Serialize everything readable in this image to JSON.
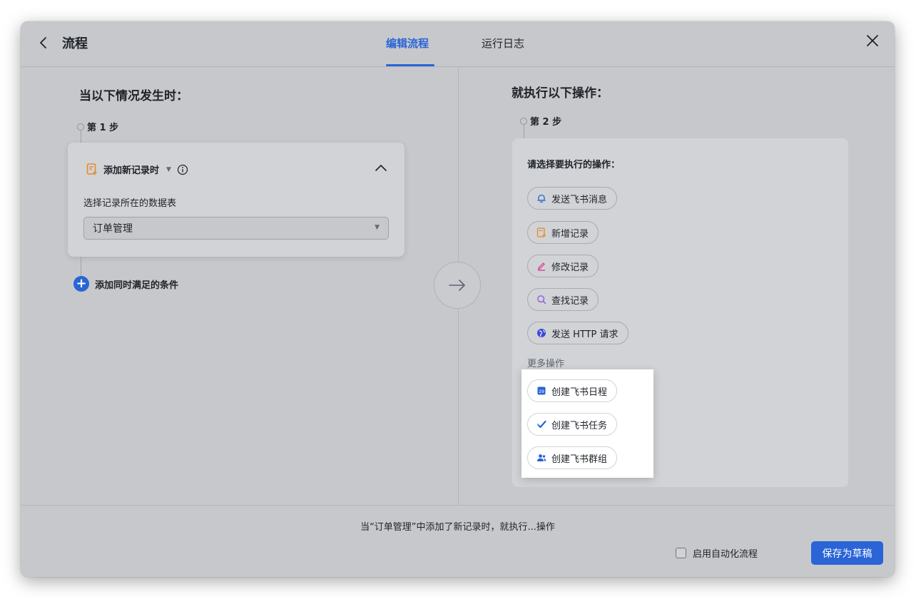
{
  "header": {
    "title": "流程",
    "tabs": [
      {
        "label": "编辑流程",
        "active": true
      },
      {
        "label": "运行日志",
        "active": false
      }
    ]
  },
  "trigger": {
    "heading": "当以下情况发生时：",
    "step_label": "第 1 步",
    "event_label": "添加新记录时",
    "field_label": "选择记录所在的数据表",
    "table_value": "订单管理",
    "add_condition": "添加同时满足的条件"
  },
  "action": {
    "heading": "就执行以下操作：",
    "step_label": "第 2 步",
    "prompt": "请选择要执行的操作：",
    "options": [
      {
        "label": "发送飞书消息",
        "icon": "bell-icon"
      },
      {
        "label": "新增记录",
        "icon": "add-record-icon"
      },
      {
        "label": "修改记录",
        "icon": "pencil-icon"
      },
      {
        "label": "查找记录",
        "icon": "search-icon"
      },
      {
        "label": "发送 HTTP 请求",
        "icon": "globe-icon"
      }
    ],
    "more_label": "更多操作",
    "more_options": [
      {
        "label": "创建飞书日程",
        "icon": "calendar-icon"
      },
      {
        "label": "创建飞书任务",
        "icon": "check-task-icon"
      },
      {
        "label": "创建飞书群组",
        "icon": "group-icon"
      }
    ]
  },
  "footer": {
    "summary": "当“订单管理”中添加了新记录时，就执行...操作",
    "enable_label": "启用自动化流程",
    "enable_checked": false,
    "save_label": "保存为草稿"
  },
  "colors": {
    "accent": "#2a64d6",
    "window_bg": "#c6c8cb",
    "card_bg": "#d1d3d6",
    "orange_icon": "#e8892b",
    "pink_icon": "#d83a8b",
    "purple_icon": "#8a55d8"
  }
}
